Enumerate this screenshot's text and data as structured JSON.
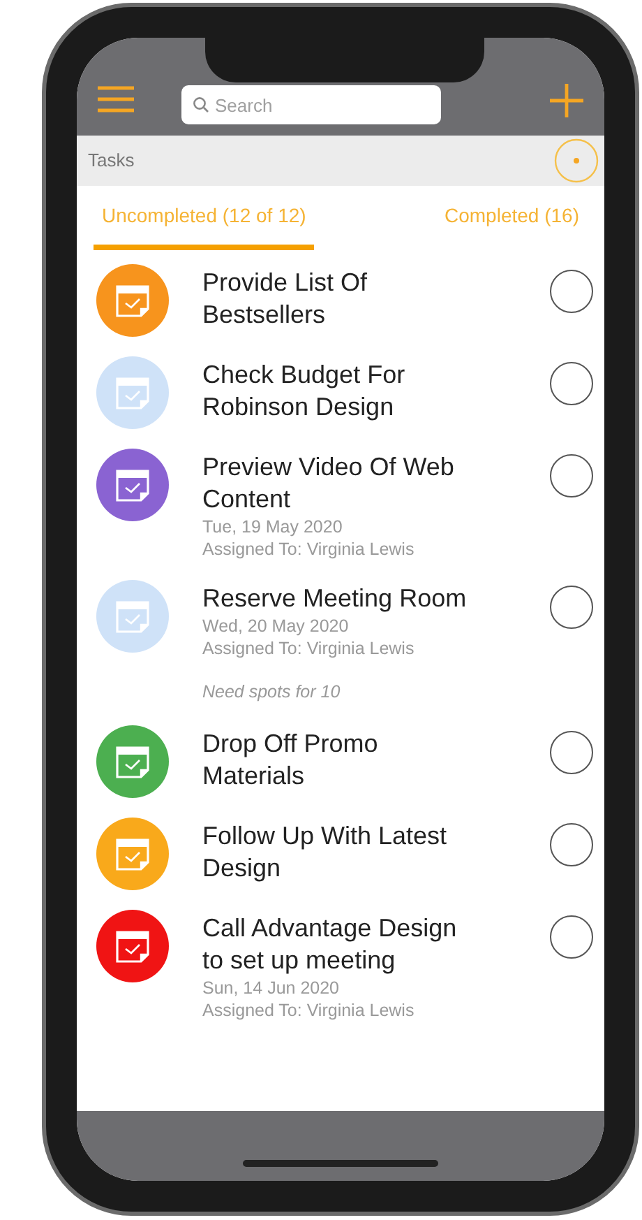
{
  "header": {
    "search": {
      "placeholder": "Search"
    }
  },
  "section_title": "Tasks",
  "tabs": [
    {
      "label": "Uncompleted (12 of 12)",
      "selected": true
    },
    {
      "label": "Completed (16)",
      "selected": false
    }
  ],
  "tasks": [
    {
      "title": "Provide List Of Bestsellers",
      "color": "#f7941d",
      "checked": false
    },
    {
      "title": "Check Budget For Robinson Design",
      "color": "#cfe2f8",
      "checked": false
    },
    {
      "title": "Preview Video Of Web Content",
      "date": "Tue, 19 May 2020",
      "assigned": "Assigned To: Virginia Lewis",
      "color": "#8a63d2",
      "checked": false
    },
    {
      "title": "Reserve Meeting Room",
      "date": "Wed, 20 May 2020",
      "assigned": "Assigned To: Virginia Lewis",
      "note": "Need spots for 10",
      "color": "#cfe2f8",
      "checked": false
    },
    {
      "title": "Drop Off Promo Materials",
      "color": "#4caf50",
      "checked": false
    },
    {
      "title": "Follow Up With Latest Design",
      "color": "#f9a91b",
      "checked": false
    },
    {
      "title": "Call Advantage Design to set up meeting",
      "date": "Sun, 14 Jun 2020",
      "assigned": "Assigned To: Virginia Lewis",
      "color": "#f01414",
      "checked": false
    }
  ]
}
